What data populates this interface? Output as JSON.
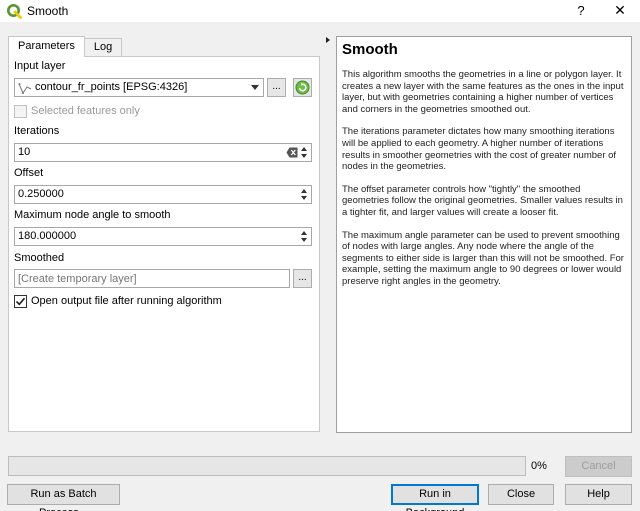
{
  "window": {
    "title": "Smooth",
    "help_glyph": "?",
    "close_glyph": "✕"
  },
  "tabs": [
    {
      "label": "Parameters",
      "active": true
    },
    {
      "label": "Log",
      "active": false
    }
  ],
  "form": {
    "input_layer": {
      "label": "Input layer",
      "value": "contour_fr_points [EPSG:4326]",
      "browse_label": "..."
    },
    "selected_only": {
      "label": "Selected features only",
      "checked": false,
      "enabled": false
    },
    "iterations": {
      "label": "Iterations",
      "value": "10"
    },
    "offset": {
      "label": "Offset",
      "value": "0.250000"
    },
    "max_angle": {
      "label": "Maximum node angle to smooth",
      "value": "180.000000"
    },
    "smoothed": {
      "label": "Smoothed",
      "placeholder": "[Create temporary layer]",
      "browse_label": "..."
    },
    "open_output": {
      "label": "Open output file after running algorithm",
      "checked": true
    }
  },
  "help": {
    "title": "Smooth",
    "paragraphs": [
      "This algorithm smooths the geometries in a line or polygon layer. It creates a new layer with the same features as the ones in the input layer, but with geometries containing a higher number of vertices and corners in the geometries smoothed out.",
      "The iterations parameter dictates how many smoothing iterations will be applied to each geometry. A higher number of iterations results in smoother geometries with the cost of greater number of nodes in the geometries.",
      "The offset parameter controls how \"tightly\" the smoothed geometries follow the original geometries. Smaller values results in a tighter fit, and larger values will create a looser fit.",
      "The maximum angle parameter can be used to prevent smoothing of nodes with large angles. Any node where the angle of the segments to either side is larger than this will not be smoothed. For example, setting the maximum angle to 90 degrees or lower would preserve right angles in the geometry."
    ]
  },
  "progress": {
    "value": 0,
    "label": "0%"
  },
  "buttons": {
    "cancel": "Cancel",
    "batch": "Run as Batch Process...",
    "run_background": "Run in Background",
    "close": "Close",
    "help": "Help"
  },
  "colors": {
    "qgis_green": "#589632",
    "qgis_yellow": "#eec900",
    "default_button_border": "#0078d7"
  }
}
